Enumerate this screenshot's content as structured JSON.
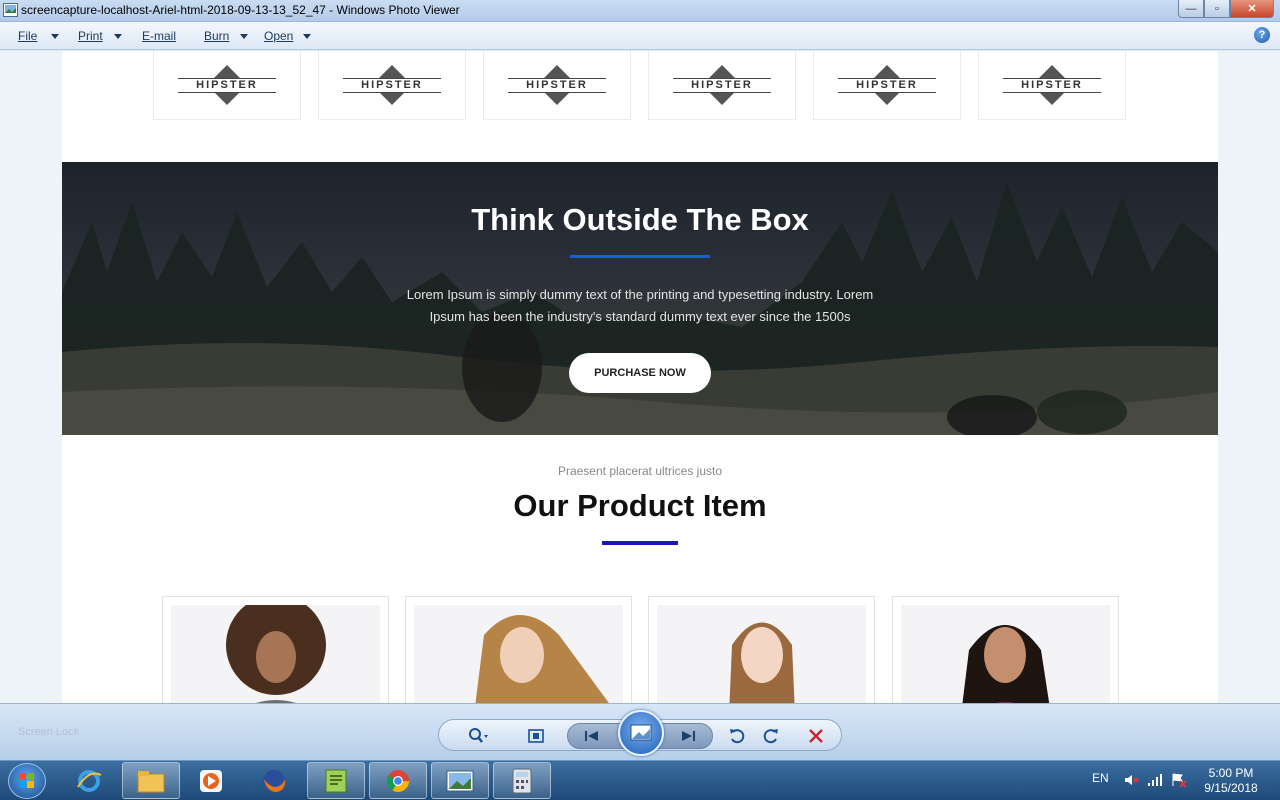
{
  "window": {
    "title": "screencapture-localhost-Ariel-html-2018-09-13-13_52_47 - Windows Photo Viewer",
    "min_glyph": "—",
    "max_glyph": "▫",
    "close_glyph": "✕"
  },
  "menu": {
    "file": "File",
    "print": "Print",
    "email": "E-mail",
    "burn": "Burn",
    "open": "Open",
    "help_glyph": "?"
  },
  "page": {
    "logo_word": "HIPSTER",
    "hero": {
      "title": "Think Outside The Box",
      "text": "Lorem Ipsum is simply dummy text of the printing and typesetting industry. Lorem Ipsum has been the industry's standard dummy text ever since the 1500s",
      "button": "PURCHASE NOW",
      "accent": "#1a5fd8"
    },
    "products": {
      "subtitle": "Praesent placerat ultrices justo",
      "title": "Our Product Item",
      "accent": "#1616c8"
    }
  },
  "viewer_toolbar": {
    "ghost_label": "Screen Lock",
    "icons": [
      "zoom-icon",
      "actual-size-icon",
      "previous-icon",
      "slideshow-icon",
      "next-icon",
      "rotate-ccw-icon",
      "rotate-cw-icon",
      "delete-icon"
    ]
  },
  "taskbar": {
    "apps": [
      "internet-explorer-icon",
      "file-explorer-icon",
      "media-player-icon",
      "firefox-icon",
      "notepad-plus-plus-icon",
      "chrome-icon",
      "photo-viewer-icon",
      "calculator-icon"
    ],
    "language": "EN",
    "time": "5:00 PM",
    "date": "9/15/2018"
  }
}
